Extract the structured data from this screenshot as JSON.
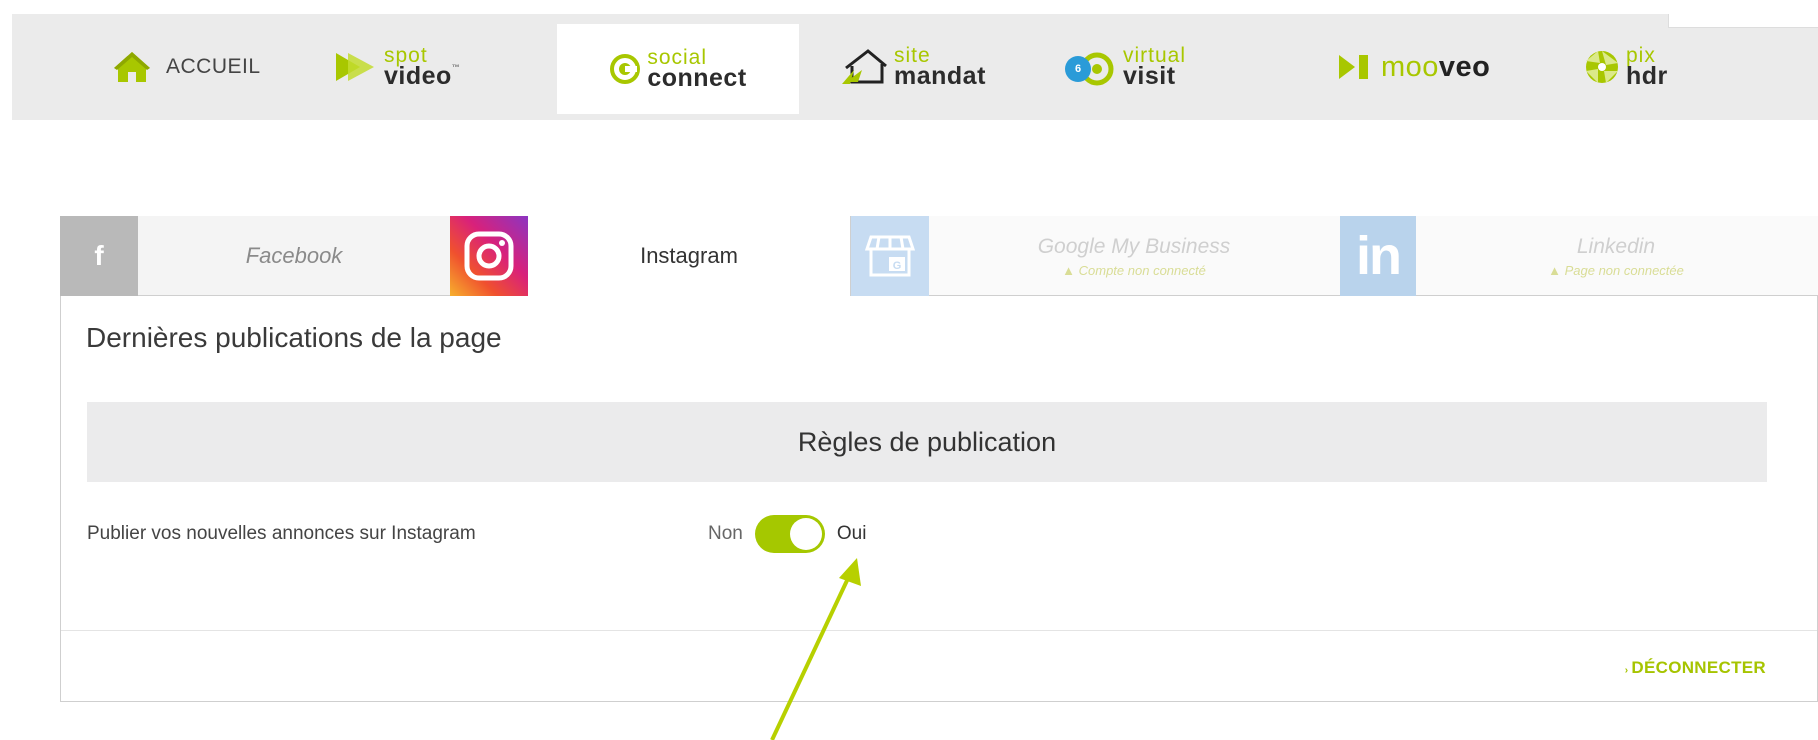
{
  "topnav": {
    "home_label": "ACCUEIL",
    "items": [
      {
        "top": "spot",
        "bottom": "video",
        "tm": "™"
      },
      {
        "top": "social",
        "bottom": "connect"
      },
      {
        "top": "site",
        "bottom": "mandat"
      },
      {
        "top": "virtual",
        "bottom": "visit",
        "badge": "6"
      },
      {
        "light": "moo",
        "bold": "veo"
      },
      {
        "top": "pix",
        "bottom": "hdr"
      }
    ],
    "active": "social connect"
  },
  "tabs": {
    "facebook": {
      "icon_letter": "f",
      "label": "Facebook"
    },
    "instagram": {
      "label": "Instagram"
    },
    "google": {
      "label": "Google My Business",
      "warning": "▲ Compte non connecté"
    },
    "linkedin": {
      "icon_letter": "in",
      "label": "Linkedin",
      "warning": "▲ Page non connectée"
    }
  },
  "content": {
    "section_title": "Dernières publications de la page",
    "rules_title": "Règles de publication",
    "setting_label": "Publier vos nouvelles annonces sur Instagram",
    "toggle_off": "Non",
    "toggle_on": "Oui",
    "toggle_state": "on",
    "disconnect_arrow": "›",
    "disconnect_label": "DÉCONNECTER"
  },
  "colors": {
    "accent": "#a5c800",
    "nav_bg": "#ebebeb",
    "rules_bg": "#ebebec",
    "badge": "#2a9bd8"
  }
}
